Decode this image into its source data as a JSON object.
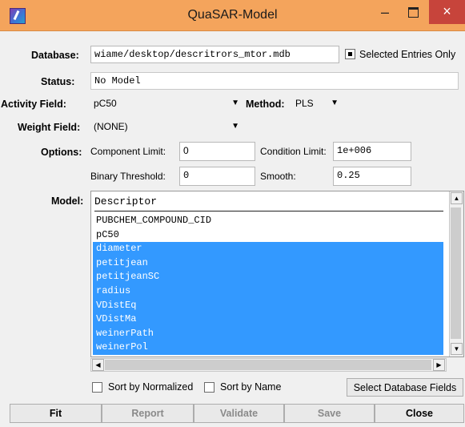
{
  "window": {
    "title": "QuaSAR-Model",
    "minimize_glyph": "–",
    "close_glyph": "×"
  },
  "database": {
    "label": "Database:",
    "value": "wiame/desktop/descritrors_mtor.mdb",
    "selected_only_label": "Selected Entries Only",
    "selected_only_checked": true
  },
  "status": {
    "label": "Status:",
    "value": "No Model"
  },
  "activity": {
    "label": "Activity Field:",
    "value": "pC50",
    "method_label": "Method:",
    "method_value": "PLS"
  },
  "weight": {
    "label": "Weight Field:",
    "value": "(NONE)"
  },
  "options": {
    "label": "Options:",
    "component_limit_label": "Component Limit:",
    "component_limit_value": "0",
    "condition_limit_label": "Condition Limit:",
    "condition_limit_value": "1e+006",
    "binary_threshold_label": "Binary Threshold:",
    "binary_threshold_value": "0",
    "smooth_label": "Smooth:",
    "smooth_value": "0.25"
  },
  "model": {
    "label": "Model:",
    "header": "Descriptor",
    "items": [
      {
        "name": "PUBCHEM_COMPOUND_CID",
        "selected": false
      },
      {
        "name": "pC50",
        "selected": false
      },
      {
        "name": "diameter",
        "selected": true
      },
      {
        "name": "petitjean",
        "selected": true
      },
      {
        "name": "petitjeanSC",
        "selected": true
      },
      {
        "name": "radius",
        "selected": true
      },
      {
        "name": "VDistEq",
        "selected": true
      },
      {
        "name": "VDistMa",
        "selected": true
      },
      {
        "name": "weinerPath",
        "selected": true
      },
      {
        "name": "weinerPol",
        "selected": true
      }
    ]
  },
  "sort": {
    "normalized_label": "Sort by Normalized",
    "name_label": "Sort by Name",
    "select_fields_label": "Select Database Fields"
  },
  "buttons": {
    "fit": "Fit",
    "report": "Report",
    "validate": "Validate",
    "save": "Save",
    "close": "Close"
  },
  "colors": {
    "titlebar": "#f4a45c",
    "close_button": "#c7443b",
    "selection": "#3399ff"
  }
}
